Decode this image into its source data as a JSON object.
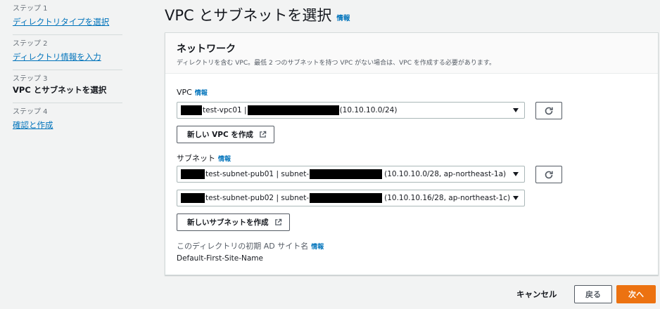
{
  "steps": [
    {
      "num": "ステップ 1",
      "label": "ディレクトリタイプを選択",
      "state": "link"
    },
    {
      "num": "ステップ 2",
      "label": "ディレクトリ情報を入力",
      "state": "link"
    },
    {
      "num": "ステップ 3",
      "label": "VPC とサブネットを選択",
      "state": "current"
    },
    {
      "num": "ステップ 4",
      "label": "確認と作成",
      "state": "link"
    }
  ],
  "page": {
    "title": "VPC とサブネットを選択",
    "info": "情報"
  },
  "network": {
    "title": "ネットワーク",
    "description": "ディレクトリを含む VPC。最低 2 つのサブネットを持つ VPC がない場合は、VPC を作成する必要があります。",
    "vpc_label": "VPC",
    "vpc_info": "情報",
    "vpc_value_name": "test-vpc01 |",
    "vpc_value_cidr": "(10.10.10.0/24)",
    "new_vpc_button": "新しい VPC を作成",
    "subnet_label": "サブネット",
    "subnet_info": "情報",
    "subnet1_name": "test-subnet-pub01 | subnet-",
    "subnet1_detail": "(10.10.10.0/28, ap-northeast-1a)",
    "subnet2_name": "test-subnet-pub02 | subnet-",
    "subnet2_detail": "(10.10.10.16/28, ap-northeast-1c)",
    "new_subnet_button": "新しいサブネットを作成",
    "site_label": "このディレクトリの初期 AD サイト名",
    "site_info": "情報",
    "site_value": "Default-First-Site-Name"
  },
  "footer": {
    "cancel": "キャンセル",
    "back": "戻る",
    "next": "次へ"
  },
  "colors": {
    "link": "#0073bb",
    "primary": "#ec7211",
    "background": "#f2f3f3"
  },
  "icons": {
    "refresh": "refresh-icon",
    "external": "external-link-icon",
    "caret": "caret-down-icon"
  }
}
